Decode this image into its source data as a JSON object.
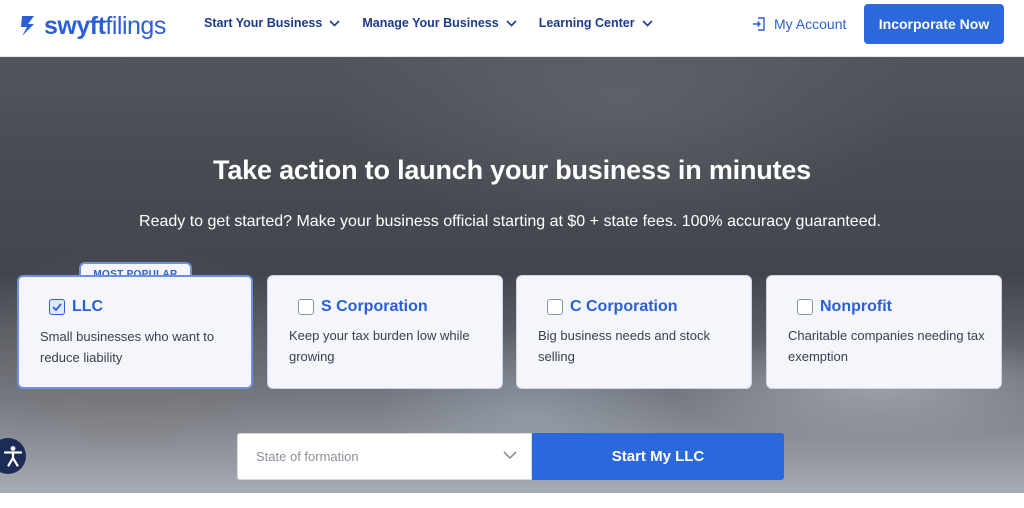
{
  "brand": {
    "name_part1": "swyft",
    "name_part2": "filings",
    "color": "#2b5fd8"
  },
  "nav": {
    "items": [
      {
        "label": "Start Your Business",
        "icon": "chevron-down-icon"
      },
      {
        "label": "Manage Your Business",
        "icon": "chevron-down-icon"
      },
      {
        "label": "Learning Center",
        "icon": "chevron-down-icon"
      }
    ],
    "account_label": "My Account",
    "account_icon": "login-icon",
    "cta_label": "Incorporate Now"
  },
  "hero": {
    "title": "Take action to launch your business in minutes",
    "subtitle": "Ready to get started? Make your business official starting at $0 + state fees. 100% accuracy guaranteed.",
    "badge": "MOST POPULAR",
    "entity_options": [
      {
        "title": "LLC",
        "description": "Small businesses who want to reduce liability",
        "checked": true
      },
      {
        "title": "S Corporation",
        "description": "Keep your tax burden low while growing",
        "checked": false
      },
      {
        "title": "C Corporation",
        "description": "Big business needs and stock selling",
        "checked": false
      },
      {
        "title": "Nonprofit",
        "description": "Charitable companies needing tax exemption",
        "checked": false
      }
    ],
    "state_placeholder": "State of formation",
    "start_button_label": "Start My LLC"
  },
  "colors": {
    "accent": "#2b68dc",
    "nav_text": "#1e3a8a",
    "card_bg": "#f4f6fb",
    "a11y_button": "#1d2b57"
  },
  "accessibility_icon": "accessibility-icon"
}
